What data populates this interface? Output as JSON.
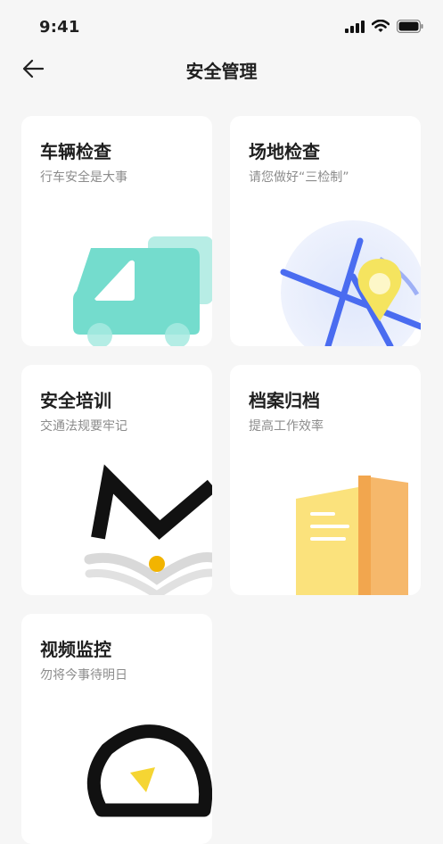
{
  "status_bar": {
    "time": "9:41"
  },
  "nav": {
    "title": "安全管理",
    "back_icon": "arrow-left-icon"
  },
  "cards": [
    {
      "id": "vehicle",
      "title": "车辆检查",
      "subtitle": "行车安全是大事",
      "icon": "truck-icon",
      "accent": "#5fd6c6"
    },
    {
      "id": "site",
      "title": "场地检查",
      "subtitle": "请您做好“三检制”",
      "icon": "map-pin-icon",
      "accent": "#4a6cf0"
    },
    {
      "id": "training",
      "title": "安全培训",
      "subtitle": "交通法规要牢记",
      "icon": "open-book-icon",
      "accent": "#f2b400"
    },
    {
      "id": "archive",
      "title": "档案归档",
      "subtitle": "提高工作效率",
      "icon": "document-folder-icon",
      "accent": "#f7b26a"
    },
    {
      "id": "video",
      "title": "视频监控",
      "subtitle": "勿将今事待明日",
      "icon": "camera-icon",
      "accent": "#f5d533"
    }
  ]
}
